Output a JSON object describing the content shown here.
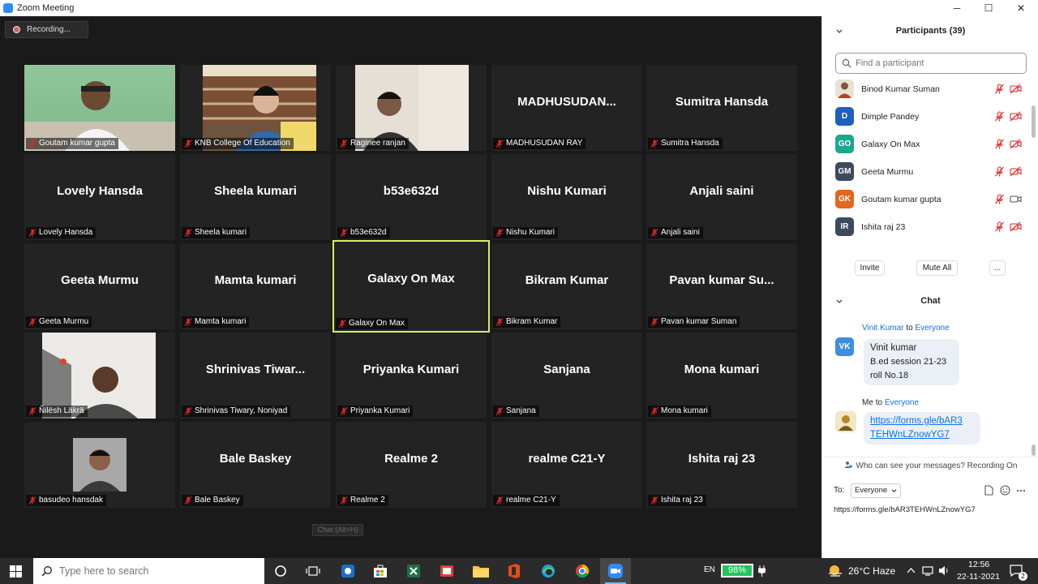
{
  "window": {
    "title": "Zoom Meeting",
    "minimize": "─",
    "maximize": "☐",
    "close": "✕"
  },
  "recording": {
    "label": "Recording..."
  },
  "tooltip": "Chat (Alt+H)",
  "tiles": [
    {
      "big": "",
      "label": "Goutam kumar gupta",
      "video": true
    },
    {
      "big": "",
      "label": "KNB College Of Education",
      "video": true
    },
    {
      "big": "",
      "label": "Raginee ranjan",
      "video": true
    },
    {
      "big": "MADHUSUDAN...",
      "label": "MADHUSUDAN RAY"
    },
    {
      "big": "Sumitra Hansda",
      "label": "Sumitra Hansda"
    },
    {
      "big": "Lovely Hansda",
      "label": "Lovely Hansda"
    },
    {
      "big": "Sheela kumari",
      "label": "Sheela kumari"
    },
    {
      "big": "b53e632d",
      "label": "b53e632d"
    },
    {
      "big": "Nishu Kumari",
      "label": "Nishu Kumari"
    },
    {
      "big": "Anjali saini",
      "label": "Anjali saini"
    },
    {
      "big": "Geeta Murmu",
      "label": "Geeta Murmu"
    },
    {
      "big": "Mamta kumari",
      "label": "Mamta kumari"
    },
    {
      "big": "Galaxy On Max",
      "label": "Galaxy On Max",
      "active": true
    },
    {
      "big": "Bikram Kumar",
      "label": "Bikram Kumar"
    },
    {
      "big": "Pavan kumar Su...",
      "label": "Pavan kumar Suman"
    },
    {
      "big": "",
      "label": "Ñilësh Läkrä",
      "video": true
    },
    {
      "big": "Shrinivas  Tiwar...",
      "label": "Shrinivas Tiwary, Noniyad"
    },
    {
      "big": "Priyanka Kumari",
      "label": "Priyanka Kumari"
    },
    {
      "big": "Sanjana",
      "label": "Sanjana"
    },
    {
      "big": "Mona kumari",
      "label": "Mona kumari"
    },
    {
      "big": "",
      "label": "basudeo hansdak",
      "video": true
    },
    {
      "big": "Bale Baskey",
      "label": "Bale Baskey"
    },
    {
      "big": "Realme 2",
      "label": "Realme 2"
    },
    {
      "big": "realme C21-Y",
      "label": "realme C21-Y"
    },
    {
      "big": "Ishita raj 23",
      "label": "Ishita raj 23"
    }
  ],
  "participants": {
    "title": "Participants (39)",
    "search_placeholder": "Find a participant",
    "list": [
      {
        "initials": "",
        "name": "Binod Kumar Suman",
        "color": "#8a7a5a",
        "photo": true,
        "cam_on": false
      },
      {
        "initials": "D",
        "name": "Dimple Pandey",
        "color": "#1f5fbf",
        "cam_on": false
      },
      {
        "initials": "GO",
        "name": "Galaxy On Max",
        "color": "#1aa88e",
        "cam_on": false
      },
      {
        "initials": "GM",
        "name": "Geeta Murmu",
        "color": "#3b4a5c",
        "cam_on": false
      },
      {
        "initials": "GK",
        "name": "Goutam kumar gupta",
        "color": "#e3671d",
        "cam_on": true
      },
      {
        "initials": "IR",
        "name": "Ishita raj 23",
        "color": "#3b4a5c",
        "cam_on": false
      }
    ],
    "invite": "Invite",
    "mute_all": "Mute All",
    "more": "..."
  },
  "chat": {
    "title": "Chat",
    "messages": [
      {
        "sender": "Vinit Kumar",
        "to_word": "to",
        "recipient": "Everyone",
        "initials": "VK",
        "color": "#3d8ee0",
        "lines": [
          "Vinit kumar",
          "B.ed session 21-23",
          "roll No.18"
        ]
      },
      {
        "sender": "Me",
        "to_word": "to",
        "recipient": "Everyone",
        "link_lines": [
          "https://forms.gle/bAR3",
          "TEHWnLZnowYG7"
        ]
      }
    ],
    "privacy_notice": "Who can see your messages? Recording On",
    "to_label": "To:",
    "recipient_select": "Everyone",
    "input_value": "https://forms.gle/bAR3TEHWnLZnowYG7"
  },
  "taskbar": {
    "search_placeholder": "Type here to search",
    "language": "EN",
    "battery": "98%",
    "weather": "26°C  Haze",
    "time": "12:56",
    "date": "22-11-2021",
    "notifications": "2"
  },
  "colors": {
    "accent": "#2d8cff",
    "active_speaker": "#d9ee62",
    "mic_muted": "#e02828",
    "link": "#0e71eb"
  }
}
